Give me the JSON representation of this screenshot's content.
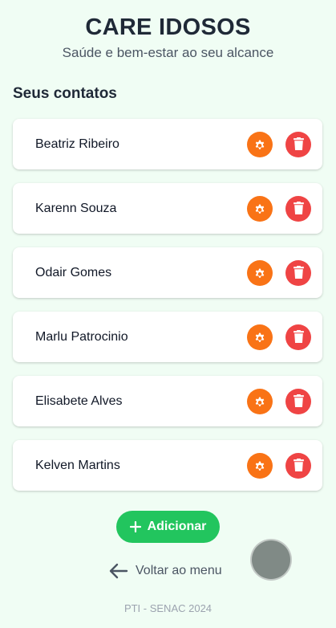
{
  "header": {
    "title": "CARE IDOSOS",
    "subtitle": "Saúde e bem-estar ao seu alcance"
  },
  "section": {
    "title": "Seus contatos"
  },
  "contacts": [
    {
      "name": "Beatriz Ribeiro"
    },
    {
      "name": "Karenn Souza"
    },
    {
      "name": "Odair Gomes"
    },
    {
      "name": "Marlu Patrocinio"
    },
    {
      "name": "Elisabete Alves"
    },
    {
      "name": "Kelven Martins"
    }
  ],
  "actions": {
    "add_label": "Adicionar",
    "back_label": "Voltar ao menu"
  },
  "footer": {
    "text": "PTI - SENAC 2024"
  },
  "colors": {
    "background": "#f0fdf4",
    "settings": "#f97316",
    "delete": "#ef4444",
    "add": "#22c55e"
  },
  "icons": {
    "settings": "gear-icon",
    "delete": "trash-icon",
    "add": "plus-icon",
    "back": "arrow-left-icon"
  }
}
